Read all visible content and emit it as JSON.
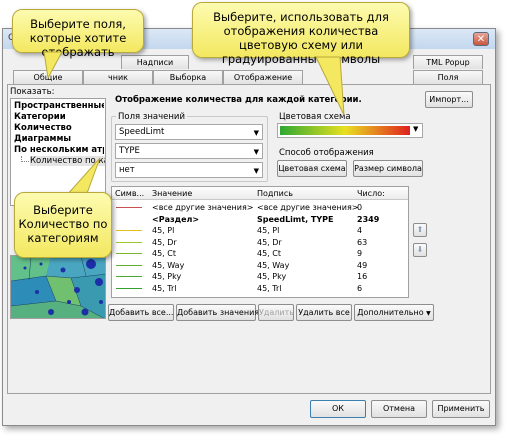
{
  "tabs_back": [
    "Надписи",
    "TML Popup"
  ],
  "tabs_front": [
    "Общие",
    "чник",
    "Выборка",
    "Отображение",
    "Поля"
  ],
  "show_label": "Показать:",
  "tree": [
    "Пространственные с",
    "Категории",
    "Количество",
    "Диаграммы",
    "По нескольким атри"
  ],
  "tree_sub": "Количество по катег",
  "section_title": "Отображение количества для каждой категории.",
  "import_button": "Импорт...",
  "value_fields": {
    "group_label": "Поля значений",
    "combo1": "SpeedLimt",
    "combo2": "TYPE",
    "combo3": "нет"
  },
  "color_scheme": {
    "group_label": "Цветовая схема",
    "gradient_colors": [
      "#2ea832",
      "#e8e020",
      "#e02020"
    ]
  },
  "display_method": {
    "group_label": "Способ отображения",
    "color_button": "Цветовая схема",
    "size_button": "Размер символа"
  },
  "grid": {
    "headers": [
      "Симв...",
      "Значение",
      "Подпись",
      "Число:"
    ],
    "rows": [
      {
        "value": "<все другие значения>",
        "label": "<все другие значения>",
        "count": "0",
        "color": "#c85050",
        "bold": false
      },
      {
        "value": "<Раздел>",
        "label": "SpeedLimt, TYPE",
        "count": "2349",
        "color": "",
        "bold": true
      },
      {
        "value": "45, Pl",
        "label": "45, Pl",
        "count": "4",
        "color": "#e0c020",
        "bold": false
      },
      {
        "value": "45, Dr",
        "label": "45, Dr",
        "count": "63",
        "color": "#9cc830",
        "bold": false
      },
      {
        "value": "45, Ct",
        "label": "45, Ct",
        "count": "9",
        "color": "#7ab830",
        "bold": false
      },
      {
        "value": "45, Way",
        "label": "45, Way",
        "count": "49",
        "color": "#60b030",
        "bold": false
      },
      {
        "value": "45, Pky",
        "label": "45, Pky",
        "count": "16",
        "color": "#48a830",
        "bold": false
      },
      {
        "value": "45, Trl",
        "label": "45, Trl",
        "count": "6",
        "color": "#34a030",
        "bold": false
      }
    ]
  },
  "bottom_buttons": {
    "add_all": "Добавить все...",
    "add_values": "Добавить значения",
    "remove": "Удалить",
    "remove_all": "Удалить все",
    "advanced": "Дополнительно"
  },
  "dialog_buttons": {
    "ok": "ОК",
    "cancel": "Отмена",
    "apply": "Применить"
  },
  "callouts": {
    "fields": "Выберите поля, которые хотите отображать",
    "scheme": "Выберите, использовать для отображения количества цветовую схему или градуированные символы",
    "category": "Выберите Количество по категориям"
  },
  "title_fragment": "С"
}
